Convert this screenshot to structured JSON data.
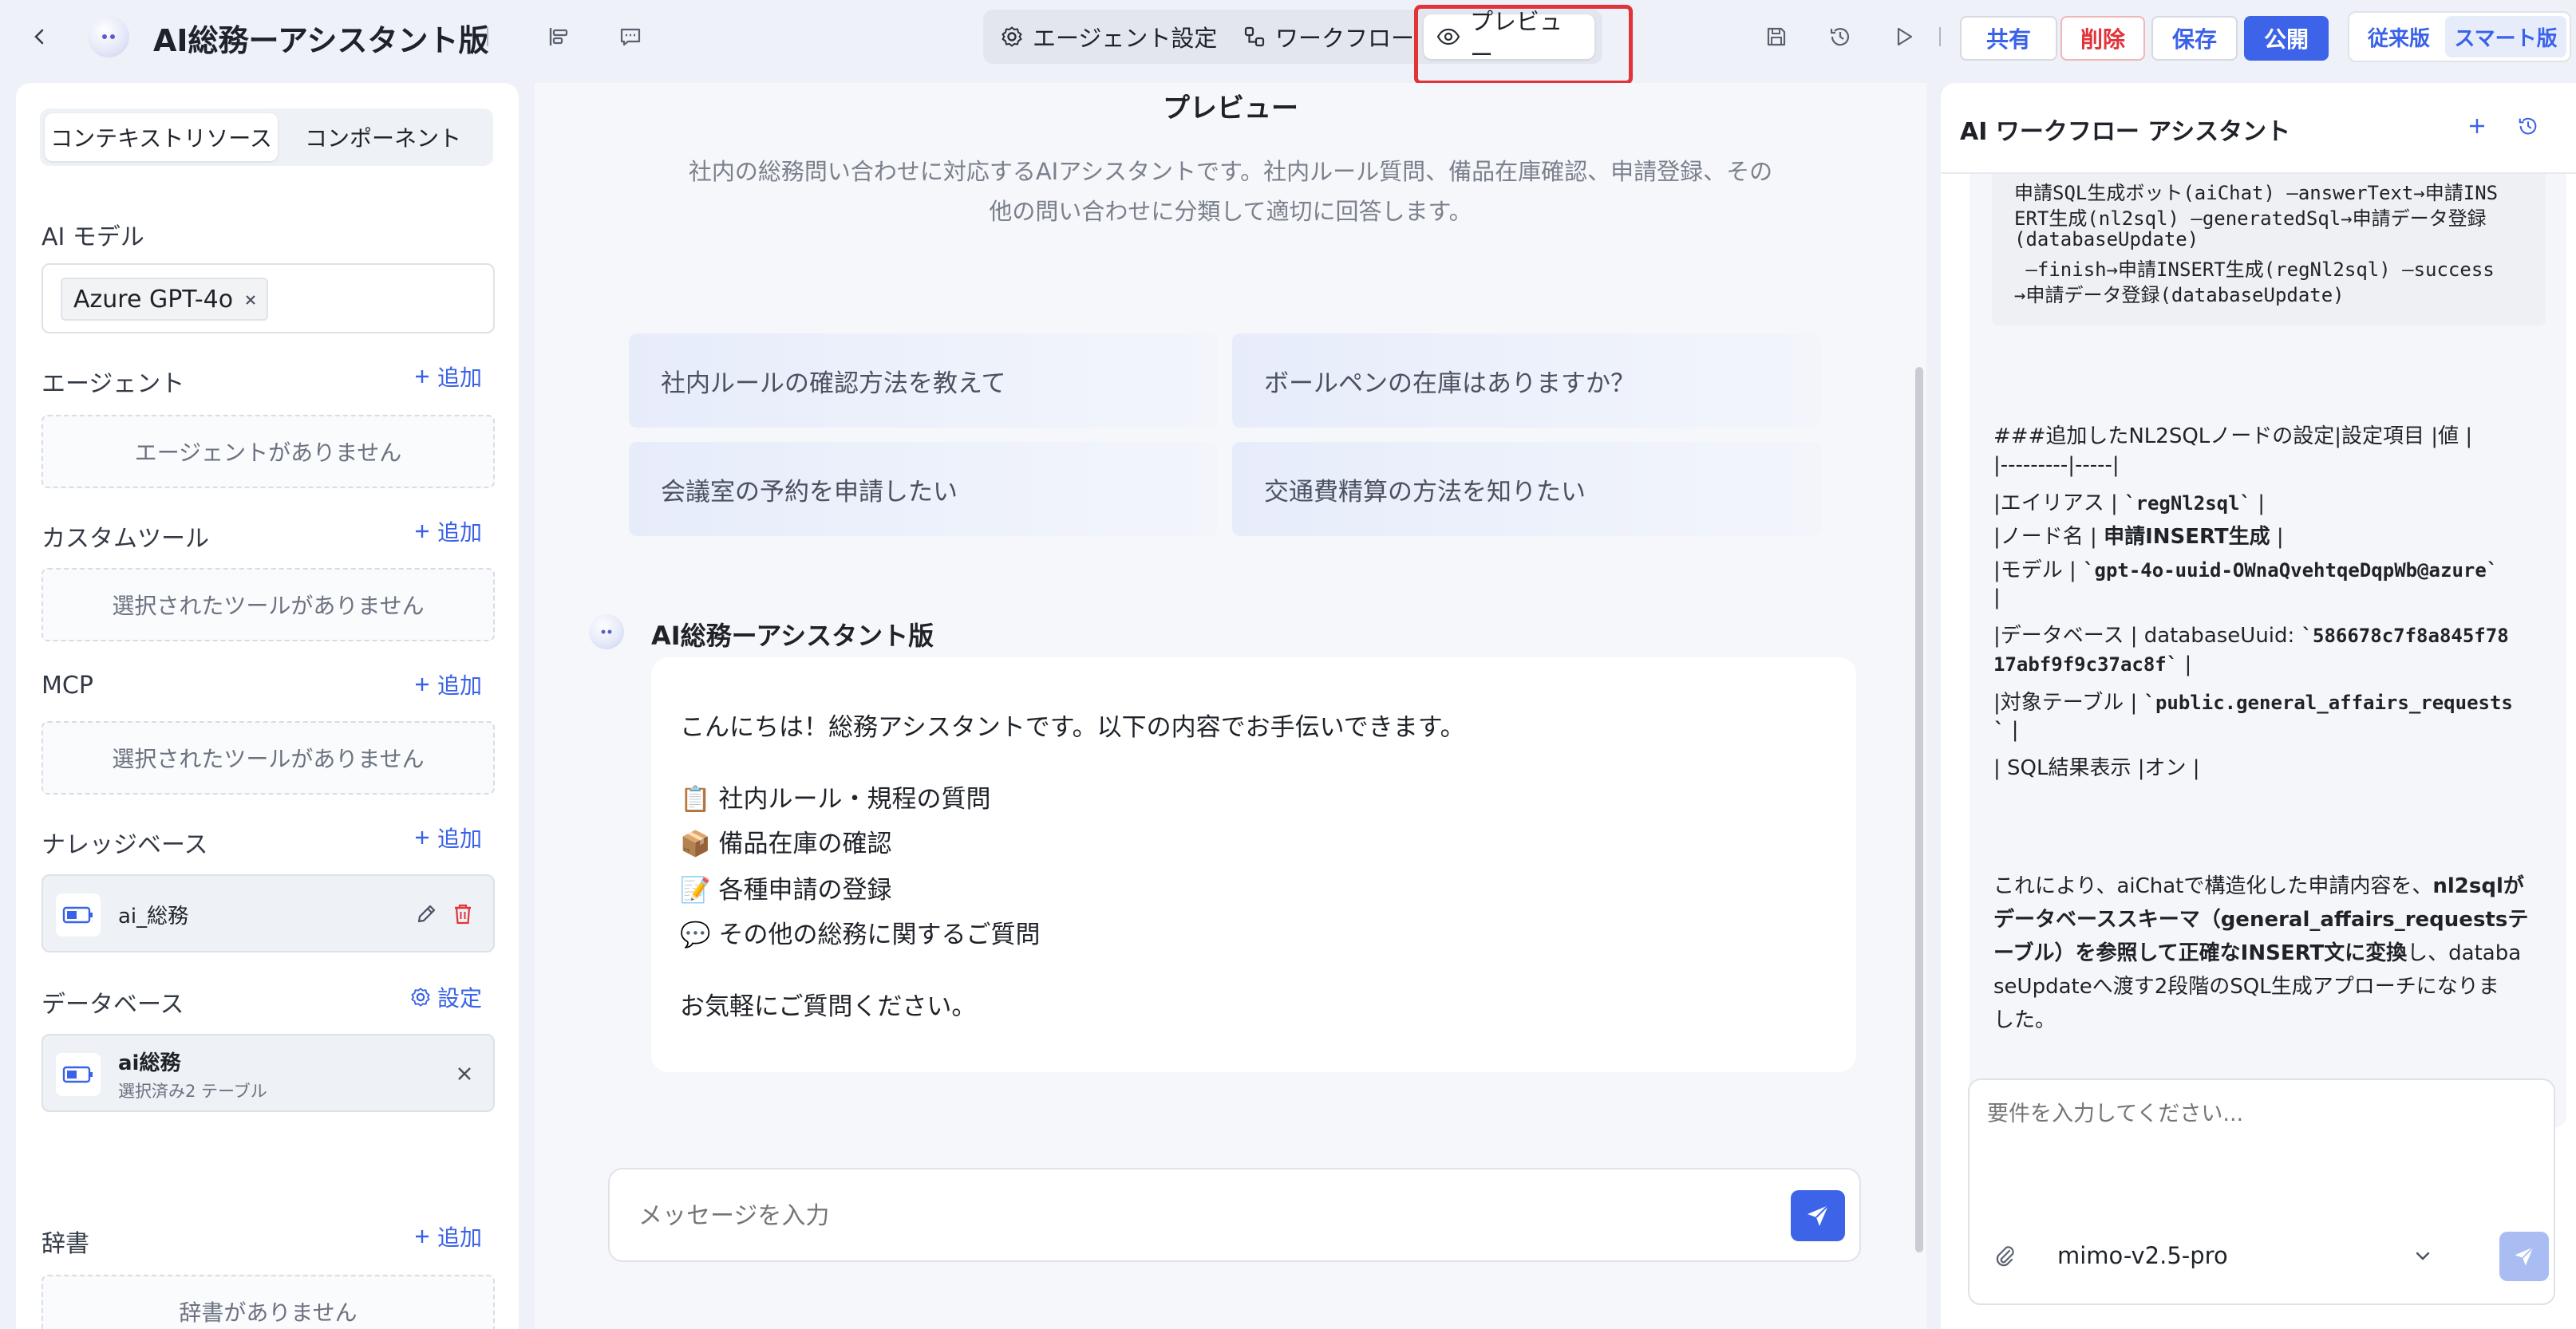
{
  "header": {
    "app_title": "AI総務ーアシスタント版",
    "tabs": [
      {
        "label": "エージェント設定"
      },
      {
        "label": "ワークフロー"
      },
      {
        "label": "プレビュー"
      }
    ],
    "buttons": {
      "share": "共有",
      "delete": "削除",
      "save": "保存",
      "publish": "公開"
    },
    "version_toggle": {
      "classic": "従来版",
      "smart": "スマート版"
    }
  },
  "left_panel": {
    "segments": [
      "コンテキストリソース",
      "コンポーネント"
    ],
    "ai_model": {
      "title": "AI モデル",
      "selected": "Azure GPT-4o"
    },
    "add_label": "追加",
    "agents": {
      "title": "エージェント",
      "empty": "エージェントがありません"
    },
    "custom_tools": {
      "title": "カスタムツール",
      "empty": "選択されたツールがありません"
    },
    "mcp": {
      "title": "MCP",
      "empty": "選択されたツールがありません"
    },
    "knowledge": {
      "title": "ナレッジベース",
      "item": "ai_総務"
    },
    "database": {
      "title": "データベース",
      "settings": "設定",
      "item_name": "ai総務",
      "item_sub": "選択済み2 テーブル"
    },
    "dictionary": {
      "title": "辞書",
      "empty": "辞書がありません"
    }
  },
  "preview": {
    "title": "プレビュー",
    "description_line1": "社内の総務問い合わせに対応するAIアシスタントです。社内ルール質問、備品在庫確認、申請登録、その",
    "description_line2": "他の問い合わせに分類して適切に回答します。",
    "suggestions": [
      "社内ルールの確認方法を教えて",
      "ボールペンの在庫はありますか？",
      "会議室の予約を申請したい",
      "交通費精算の方法を知りたい"
    ],
    "bot_name": "AI総務ーアシスタント版",
    "message": {
      "greeting": "こんにちは！総務アシスタントです。以下の内容でお手伝いできます。",
      "items": [
        {
          "emoji": "📋",
          "text": "社内ルール・規程の質問"
        },
        {
          "emoji": "📦",
          "text": "備品在庫の確認"
        },
        {
          "emoji": "📝",
          "text": "各種申請の登録"
        },
        {
          "emoji": "💬",
          "text": "その他の総務に関するご質問"
        }
      ],
      "closing": "お気軽にご質問ください。"
    },
    "input_placeholder": "メッセージを入力"
  },
  "assistant": {
    "title": "AI ワークフロー アシスタント",
    "code_lines": [
      "申請SQL生成ボット(aiChat) —answerText→申請INS",
      "ERT生成(nl2sql) —generatedSql→申請データ登録",
      "(databaseUpdate)",
      " —finish→申請INSERT生成(regNl2sql) —success",
      "→申請データ登録(databaseUpdate)"
    ],
    "table_header": "###追加したNL2SQLノードの設定|設定項目 |値 |",
    "table_sep": "|---------|-----|",
    "row_alias_label": "|エイリアス | ",
    "row_alias_value": "`regNl2sql`",
    "row_alias_end": " |",
    "row_node_label": "|ノード名 | ",
    "row_node_value": "申請INSERT生成",
    "row_node_end": " |",
    "row_model_label": "|モデル | ",
    "row_model_value": "`gpt-4o-uuid-OWnaQvehtqeDqpWb@azure`",
    "row_model_end": "|",
    "row_db_label": "|データベース | databaseUuid: ",
    "row_db_value1": "`586678c7f8a845f78",
    "row_db_value2": "17abf9f9c37ac8f`",
    "row_db_end": " |",
    "row_table_label": "|対象テーブル | ",
    "row_table_value1": "`public.general_affairs_requests",
    "row_table_value2": "`",
    "row_table_end": " |",
    "row_sql": "| SQL結果表示 |オン |",
    "summary_l1_a": "これにより、aiChatで構造化した申請内容を、",
    "summary_l1_b": "nl2sqlが",
    "summary_l2": "データベーススキーマ（general_affairs_requestsテ",
    "summary_l3_a": "ーブル）を参照して正確なINSERT文に変換",
    "summary_l3_b": "し、databa",
    "summary_l4": "seUpdateへ渡す2段階のSQL生成アプローチになりま",
    "summary_l5": "した。",
    "input_placeholder": "要件を入力してください...",
    "model": "mimo-v2.5-pro"
  },
  "colors": {
    "accent": "#3a62e8",
    "publish": "#3d63e8",
    "delete": "#e0343a",
    "highlight_border": "#e0343a"
  }
}
